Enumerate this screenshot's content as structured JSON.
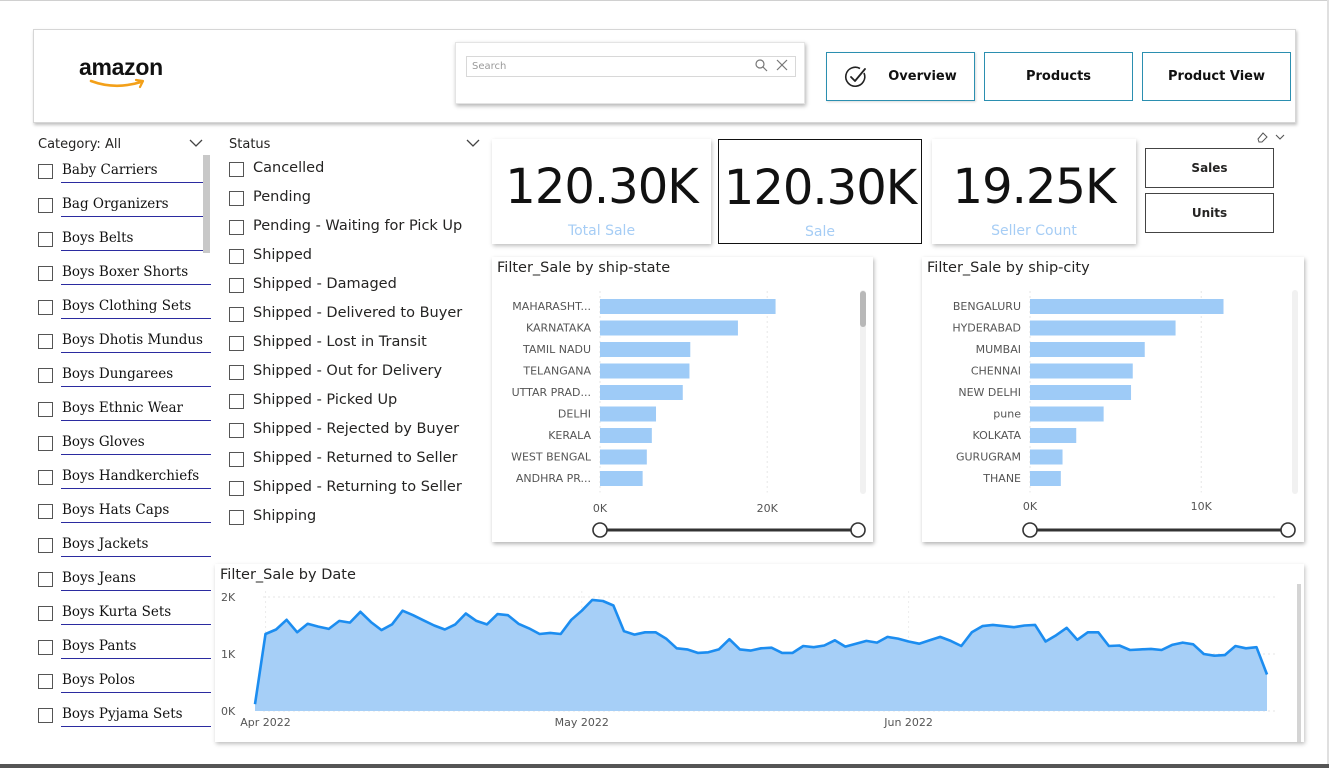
{
  "header": {
    "logo_text": "amazon",
    "search_placeholder": "Search",
    "nav": {
      "overview": "Overview",
      "products": "Products",
      "product_view": "Product View"
    }
  },
  "category": {
    "title": "Category: All",
    "items": [
      "Baby Carriers",
      "Bag Organizers",
      "Boys Belts",
      "Boys Boxer Shorts",
      "Boys Clothing Sets",
      "Boys Dhotis Mundus",
      "Boys Dungarees",
      "Boys Ethnic Wear",
      "Boys Gloves",
      "Boys Handkerchiefs",
      "Boys Hats Caps",
      "Boys Jackets",
      "Boys Jeans",
      "Boys Kurta Sets",
      "Boys Pants",
      "Boys Polos",
      "Boys Pyjama Sets"
    ]
  },
  "status": {
    "title": "Status",
    "items": [
      "Cancelled",
      "Pending",
      "Pending - Waiting for Pick Up",
      "Shipped",
      "Shipped - Damaged",
      "Shipped - Delivered to Buyer",
      "Shipped - Lost in Transit",
      "Shipped - Out for Delivery",
      "Shipped - Picked Up",
      "Shipped - Rejected by Buyer",
      "Shipped - Returned to Seller",
      "Shipped - Returning to Seller",
      "Shipping"
    ]
  },
  "cards": [
    {
      "value": "120.30K",
      "label": "Total Sale"
    },
    {
      "value": "120.30K",
      "label": "Sale"
    },
    {
      "value": "19.25K",
      "label": "Seller Count"
    }
  ],
  "toggles": {
    "sales": "Sales",
    "units": "Units"
  },
  "colors": {
    "bar": "#9ecbf7",
    "line": "#1c8df0",
    "area": "#a6cff7",
    "accent_border": "#2b8fb0"
  },
  "chart_data": [
    {
      "type": "bar",
      "title": "Filter_Sale by ship-state",
      "categories": [
        "MAHARASHT...",
        "KARNATAKA",
        "TAMIL NADU",
        "TELANGANA",
        "UTTAR PRAD...",
        "DELHI",
        "KERALA",
        "WEST BENGAL",
        "ANDHRA PR..."
      ],
      "values": [
        21000,
        16500,
        10800,
        10700,
        9900,
        6700,
        6200,
        5600,
        5100
      ],
      "xticks": [
        "0K",
        "20K"
      ],
      "xlim": [
        0,
        25000
      ],
      "orientation": "horizontal"
    },
    {
      "type": "bar",
      "title": "Filter_Sale by ship-city",
      "categories": [
        "BENGALURU",
        "HYDERABAD",
        "MUMBAI",
        "CHENNAI",
        "NEW DELHI",
        "pune",
        "KOLKATA",
        "GURUGRAM",
        "THANE"
      ],
      "values": [
        11300,
        8500,
        6700,
        6000,
        5900,
        4300,
        2700,
        1900,
        1800
      ],
      "xticks": [
        "0K",
        "10K"
      ],
      "xlim": [
        0,
        16000
      ],
      "orientation": "horizontal"
    },
    {
      "type": "area",
      "title": "Filter_Sale by Date",
      "x": [
        "2022-03-31",
        "2022-04-01",
        "2022-04-02",
        "2022-04-03",
        "2022-04-04",
        "2022-04-05",
        "2022-04-06",
        "2022-04-07",
        "2022-04-08",
        "2022-04-09",
        "2022-04-10",
        "2022-04-11",
        "2022-04-12",
        "2022-04-13",
        "2022-04-14",
        "2022-04-15",
        "2022-04-16",
        "2022-04-17",
        "2022-04-18",
        "2022-04-19",
        "2022-04-20",
        "2022-04-21",
        "2022-04-22",
        "2022-04-23",
        "2022-04-24",
        "2022-04-25",
        "2022-04-26",
        "2022-04-27",
        "2022-04-28",
        "2022-04-29",
        "2022-04-30",
        "2022-05-01",
        "2022-05-02",
        "2022-05-03",
        "2022-05-04",
        "2022-05-05",
        "2022-05-06",
        "2022-05-07",
        "2022-05-08",
        "2022-05-09",
        "2022-05-10",
        "2022-05-11",
        "2022-05-12",
        "2022-05-13",
        "2022-05-14",
        "2022-05-15",
        "2022-05-16",
        "2022-05-17",
        "2022-05-18",
        "2022-05-19",
        "2022-05-20",
        "2022-05-21",
        "2022-05-22",
        "2022-05-23",
        "2022-05-24",
        "2022-05-25",
        "2022-05-26",
        "2022-05-27",
        "2022-05-28",
        "2022-05-29",
        "2022-05-30",
        "2022-05-31",
        "2022-06-01",
        "2022-06-02",
        "2022-06-03",
        "2022-06-04",
        "2022-06-05",
        "2022-06-06",
        "2022-06-07",
        "2022-06-08",
        "2022-06-09",
        "2022-06-10",
        "2022-06-11",
        "2022-06-12",
        "2022-06-13",
        "2022-06-14",
        "2022-06-15",
        "2022-06-16",
        "2022-06-17",
        "2022-06-18",
        "2022-06-19",
        "2022-06-20",
        "2022-06-21",
        "2022-06-22",
        "2022-06-23",
        "2022-06-24",
        "2022-06-25",
        "2022-06-26",
        "2022-06-27",
        "2022-06-28",
        "2022-06-29"
      ],
      "values": [
        120,
        1350,
        1430,
        1600,
        1380,
        1530,
        1480,
        1440,
        1580,
        1550,
        1740,
        1560,
        1420,
        1520,
        1760,
        1680,
        1590,
        1500,
        1430,
        1520,
        1710,
        1580,
        1520,
        1700,
        1680,
        1530,
        1450,
        1350,
        1370,
        1350,
        1600,
        1760,
        1950,
        1930,
        1850,
        1400,
        1340,
        1380,
        1380,
        1270,
        1100,
        1080,
        1020,
        1030,
        1080,
        1260,
        1080,
        1060,
        1100,
        1110,
        1020,
        1020,
        1140,
        1120,
        1150,
        1240,
        1130,
        1180,
        1230,
        1200,
        1300,
        1270,
        1220,
        1180,
        1240,
        1300,
        1230,
        1140,
        1380,
        1490,
        1510,
        1490,
        1470,
        1500,
        1510,
        1220,
        1330,
        1460,
        1250,
        1380,
        1380,
        1140,
        1150,
        1070,
        1080,
        1090,
        1070,
        1160,
        1200,
        1170,
        1000,
        970,
        980,
        1140,
        1100,
        1120,
        640
      ],
      "xticks": [
        "Apr 2022",
        "May 2022",
        "Jun 2022"
      ],
      "yticks": [
        "0K",
        "1K",
        "2K"
      ],
      "ylim": [
        0,
        2000
      ]
    }
  ]
}
